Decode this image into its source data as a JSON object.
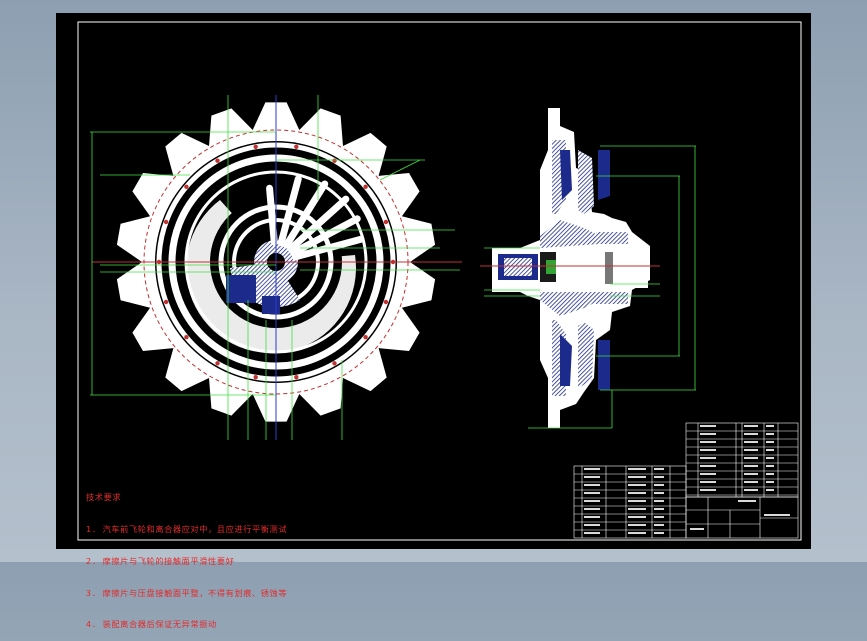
{
  "notes": {
    "title": "技术要求",
    "items": [
      "1. 汽车前飞轮和离合器应对中，且应进行平衡测试",
      "2. 摩擦片与飞轮的接触面平滑性要好",
      "3. 摩擦片与压盘接触面平整，不得有划痕、锈蚀等",
      "4. 装配离合器后保证无异常振动"
    ]
  },
  "colors": {
    "bg": "#000000",
    "frame": "#ffffff",
    "part": "#ffffff",
    "hatch": "#1c2a8c",
    "dim": "#3fe03f",
    "center": "#e02626",
    "text": "#e22b2b"
  },
  "icons": [
    "sprocket-front-view",
    "clutch-section-view"
  ]
}
